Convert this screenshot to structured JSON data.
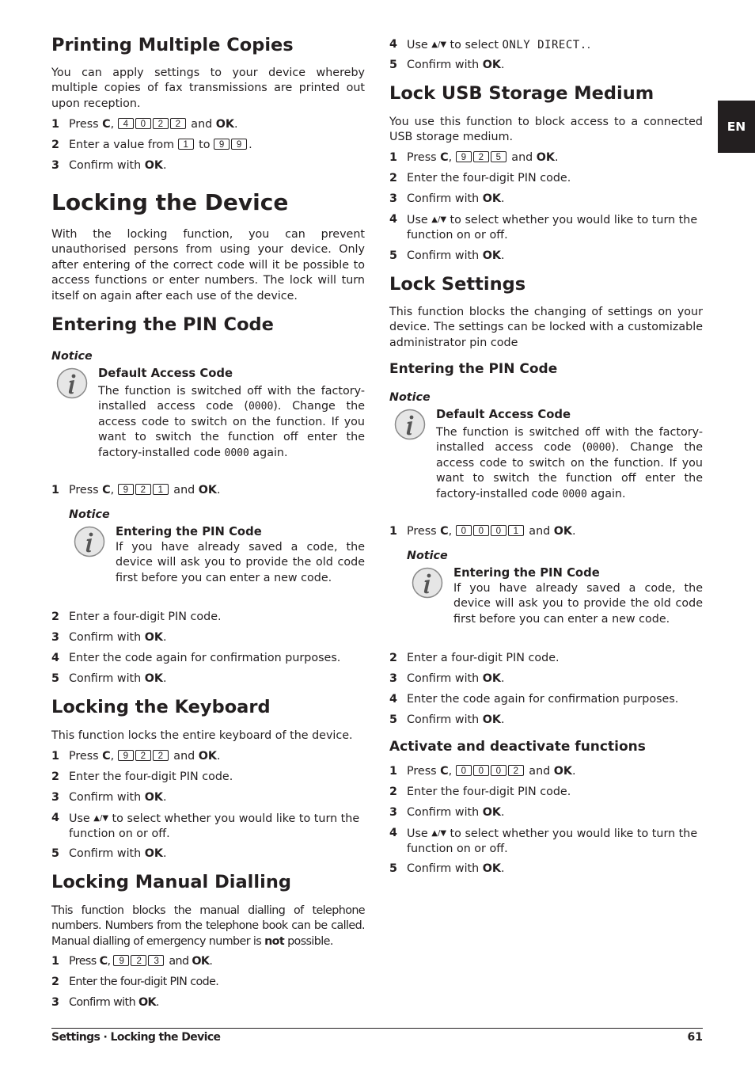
{
  "language_tab": "EN",
  "left": {
    "printing": {
      "title": "Printing Multiple Copies",
      "intro": "You can apply settings to your device whereby multiple copies of fax transmissions are printed out upon reception.",
      "steps": [
        {
          "num": "1",
          "pre": "Press ",
          "bold1": "C",
          "mid": ", ",
          "keys": [
            "4",
            "0",
            "2",
            "2"
          ],
          "post": " and ",
          "bold2": "OK",
          "end": "."
        },
        {
          "num": "2",
          "pre": "Enter a value from ",
          "keys_a": [
            "1"
          ],
          "mid": " to ",
          "keys_b": [
            "9",
            "9"
          ],
          "end": "."
        },
        {
          "num": "3",
          "pre": "Confirm with ",
          "bold": "OK",
          "end": "."
        }
      ]
    },
    "locking": {
      "title": "Locking the Device",
      "intro": "With the locking function, you can prevent unauthorised persons from using your device. Only after entering of the correct code will it be possible to access functions or enter numbers. The lock will turn itself on again after each use of the device."
    },
    "pin": {
      "title": "Entering the PIN Code",
      "notice_label": "Notice",
      "notice_title": "Default Access Code",
      "notice_text_1": "The function is switched off with the factory-installed access code (",
      "notice_code": "0000",
      "notice_text_2": "). Change the access code to switch on the function. If you want to switch the function off enter the factory-installed code ",
      "notice_text_3": " again.",
      "step1": {
        "num": "1",
        "pre": "Press ",
        "bold1": "C",
        "mid": ", ",
        "keys": [
          "9",
          "2",
          "1"
        ],
        "post": " and ",
        "bold2": "OK",
        "end": "."
      },
      "notice2_label": "Notice",
      "notice2_title": "Entering the PIN Code",
      "notice2_text": "If you have already saved a code, the device will ask you to provide the old code first before you can enter a new code.",
      "steps": [
        {
          "num": "2",
          "text": "Enter a four-digit PIN code."
        },
        {
          "num": "3",
          "pre": "Confirm with ",
          "bold": "OK",
          "end": "."
        },
        {
          "num": "4",
          "text": "Enter the code again for confirmation purposes."
        },
        {
          "num": "5",
          "pre": "Confirm with ",
          "bold": "OK",
          "end": "."
        }
      ]
    },
    "keyboard": {
      "title": "Locking the Keyboard",
      "intro": "This function locks the entire keyboard of the device.",
      "step1": {
        "num": "1",
        "pre": "Press ",
        "bold1": "C",
        "mid": ", ",
        "keys": [
          "9",
          "2",
          "2"
        ],
        "post": " and ",
        "bold2": "OK",
        "end": "."
      },
      "step2": {
        "num": "2",
        "text": "Enter the four-digit PIN code."
      },
      "step3": {
        "num": "3",
        "pre": "Confirm with ",
        "bold": "OK",
        "end": "."
      },
      "step4": {
        "num": "4",
        "pre": "Use ",
        "arrows": "▲/▼",
        "post": " to select whether you would like to turn the function on or off."
      },
      "step5": {
        "num": "5",
        "pre": "Confirm with ",
        "bold": "OK",
        "end": "."
      }
    },
    "manual": {
      "title": "Locking Manual Dialling",
      "intro_1": "This function blocks the manual dialling of telephone numbers. Numbers from the telephone book can be called. Manual dialling of emergency number is ",
      "intro_bold": "not",
      "intro_2": "  possible.",
      "step1": {
        "num": "1",
        "pre": "Press ",
        "bold1": "C",
        "mid": ", ",
        "keys": [
          "9",
          "2",
          "3"
        ],
        "post": " and ",
        "bold2": "OK",
        "end": "."
      },
      "step2": {
        "num": "2",
        "text": "Enter the four-digit PIN code."
      },
      "step3": {
        "num": "3",
        "pre": "Confirm with ",
        "bold": "OK",
        "end": "."
      }
    }
  },
  "right": {
    "top": {
      "step4": {
        "num": "4",
        "pre": "Use ",
        "arrows": "▲/▼",
        "mid": " to select ",
        "lcd": "ONLY DIRECT.",
        "end": "."
      },
      "step5": {
        "num": "5",
        "pre": "Confirm with ",
        "bold": "OK",
        "end": "."
      }
    },
    "usb": {
      "title": "Lock USB Storage Medium",
      "intro": "You use this function to block access to a connected USB storage medium.",
      "step1": {
        "num": "1",
        "pre": "Press ",
        "bold1": "C",
        "mid": ", ",
        "keys": [
          "9",
          "2",
          "5"
        ],
        "post": " and ",
        "bold2": "OK",
        "end": "."
      },
      "step2": {
        "num": "2",
        "text": "Enter the four-digit PIN code."
      },
      "step3": {
        "num": "3",
        "pre": "Confirm with ",
        "bold": "OK",
        "end": "."
      },
      "step4": {
        "num": "4",
        "pre": "Use ",
        "arrows": "▲/▼",
        "post": " to select whether you would like to turn the function on or off."
      },
      "step5": {
        "num": "5",
        "pre": "Confirm with ",
        "bold": "OK",
        "end": "."
      }
    },
    "settings": {
      "title": "Lock Settings",
      "intro": "This function blocks the changing of settings on your device. The settings can be locked with a customizable administrator pin code",
      "subtitle": "Entering the PIN Code",
      "notice_label": "Notice",
      "notice_title": "Default Access Code",
      "notice_text_1": "The function is switched off with the factory-installed access code (",
      "notice_code": "0000",
      "notice_text_2": "). Change the access code to switch on the function. If you want to switch the function off enter the factory-installed code ",
      "notice_text_3": " again.",
      "step1": {
        "num": "1",
        "pre": "Press ",
        "bold1": "C",
        "mid": ", ",
        "keys": [
          "0",
          "0",
          "0",
          "1"
        ],
        "post": " and ",
        "bold2": "OK",
        "end": "."
      },
      "notice2_label": "Notice",
      "notice2_title": "Entering the PIN Code",
      "notice2_text": "If you have already saved a code, the device will ask you to provide the old code first before you can enter a new code.",
      "steps": [
        {
          "num": "2",
          "text": "Enter a four-digit PIN code."
        },
        {
          "num": "3",
          "pre": "Confirm with ",
          "bold": "OK",
          "end": "."
        },
        {
          "num": "4",
          "text": "Enter the code again for confirmation purposes."
        },
        {
          "num": "5",
          "pre": "Confirm with ",
          "bold": "OK",
          "end": "."
        }
      ]
    },
    "activate": {
      "title": "Activate and deactivate functions",
      "step1": {
        "num": "1",
        "pre": "Press ",
        "bold1": "C",
        "mid": ", ",
        "keys": [
          "0",
          "0",
          "0",
          "2"
        ],
        "post": " and ",
        "bold2": "OK",
        "end": "."
      },
      "step2": {
        "num": "2",
        "text": "Enter the four-digit PIN code."
      },
      "step3": {
        "num": "3",
        "pre": "Confirm with ",
        "bold": "OK",
        "end": "."
      },
      "step4": {
        "num": "4",
        "pre": "Use ",
        "arrows": "▲/▼",
        "post": " to select whether you would like to turn the function on or off."
      },
      "step5": {
        "num": "5",
        "pre": "Confirm with ",
        "bold": "OK",
        "end": "."
      }
    }
  },
  "footer": {
    "section": "Settings · Locking the Device",
    "page_number": "61"
  }
}
